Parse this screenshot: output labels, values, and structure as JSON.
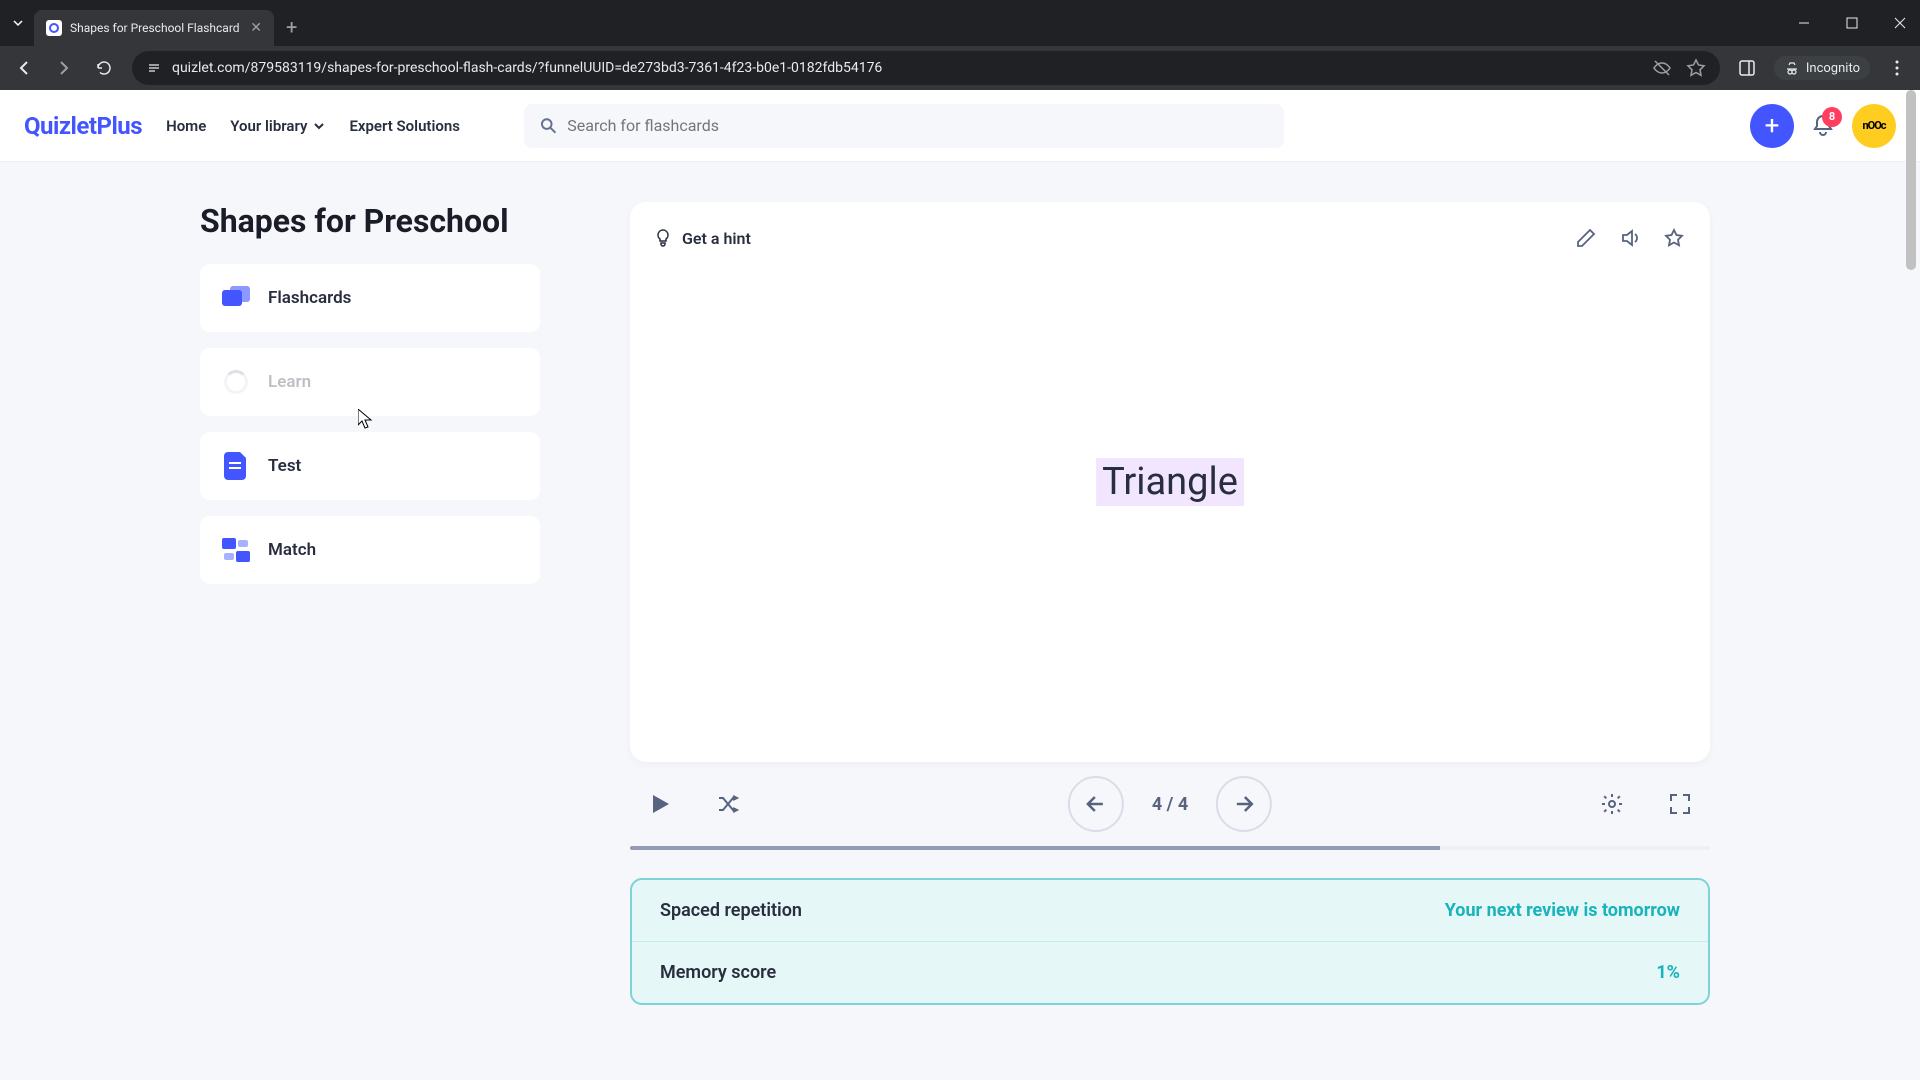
{
  "browser": {
    "tab_title": "Shapes for Preschool Flashcard",
    "url": "quizlet.com/879583119/shapes-for-preschool-flash-cards/?funnelUUID=de273bd3-7361-4f23-b0e1-0182fdb54176",
    "incognito_label": "Incognito"
  },
  "header": {
    "logo": "QuizletPlus",
    "nav": {
      "home": "Home",
      "library": "Your library",
      "expert": "Expert Solutions"
    },
    "search_placeholder": "Search for flashcards",
    "notification_count": "8",
    "avatar_text": "nOOc"
  },
  "sidebar": {
    "title": "Shapes for Preschool",
    "modes": {
      "flashcards": "Flashcards",
      "learn": "Learn",
      "test": "Test",
      "match": "Match"
    }
  },
  "card": {
    "hint": "Get a hint",
    "word": "Triangle",
    "counter": "4 / 4"
  },
  "sr": {
    "title": "Spaced repetition",
    "next": "Your next review is tomorrow",
    "memory_label": "Memory score",
    "memory_value": "1%"
  }
}
